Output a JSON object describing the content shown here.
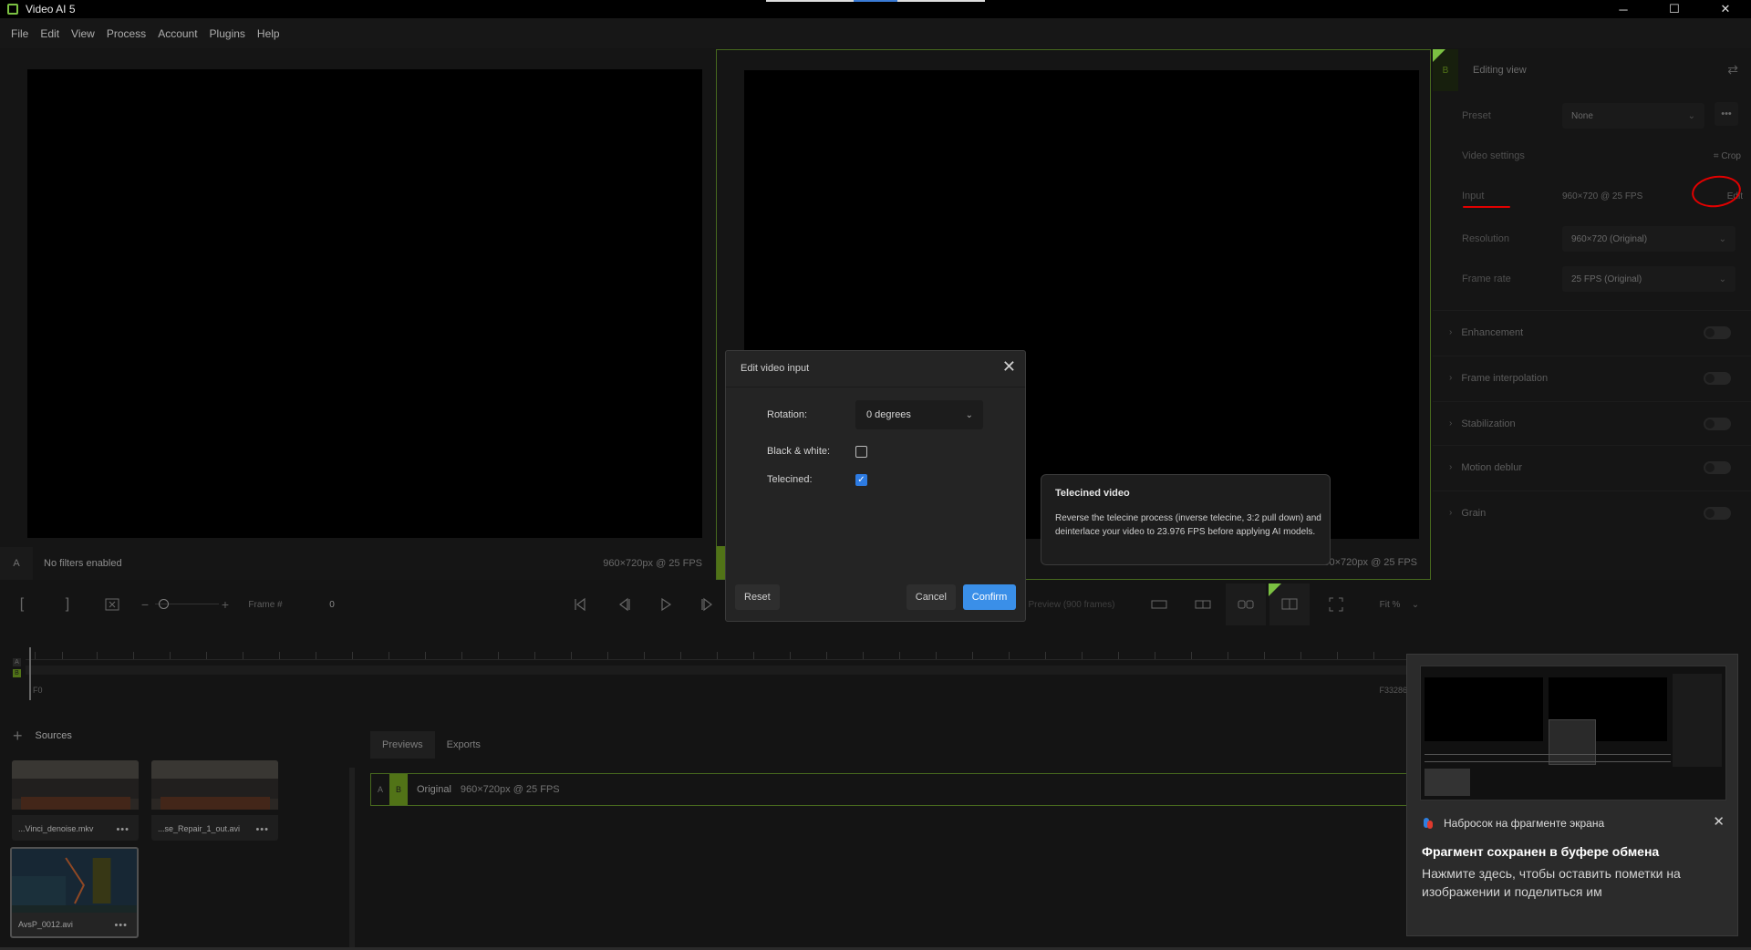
{
  "window": {
    "title": "Video AI 5",
    "controls": [
      "─",
      "☐",
      "✕"
    ]
  },
  "menu": [
    "File",
    "Edit",
    "View",
    "Process",
    "Account",
    "Plugins",
    "Help"
  ],
  "viewer_a": {
    "tag": "A",
    "filters": "No filters enabled",
    "resolution": "960×720px @ 25 FPS"
  },
  "viewer_b": {
    "resolution": "960×720px @ 25 FPS"
  },
  "controls": {
    "frame_label": "Frame #",
    "frame_value": "0",
    "preview_label": "Preview (900 frames)",
    "zoom_label": "Fit %"
  },
  "timeline": {
    "start": "F0",
    "end": "F33286",
    "marker_a": "A",
    "marker_b": "B"
  },
  "sources": {
    "header": "Sources",
    "items": [
      {
        "name": "...Vinci_denoise.mkv",
        "dots": "•••"
      },
      {
        "name": "...se_Repair_1_out.avi",
        "dots": "•••"
      },
      {
        "name": "AvsP_0012.avi",
        "dots": "•••"
      }
    ]
  },
  "preview_tabs": [
    "Previews",
    "Exports"
  ],
  "preview_row": {
    "a": "A",
    "b": "B",
    "title": "Original",
    "meta": "960×720px @ 25 FPS"
  },
  "right_panel": {
    "tag": "B",
    "title": "Editing view",
    "preset_label": "Preset",
    "preset_value": "None",
    "more": "•••",
    "video_settings_label": "Video settings",
    "crop_label": "Crop",
    "input_label": "Input",
    "input_value": "960×720 @ 25 FPS",
    "edit_label": "Edit",
    "resolution_label": "Resolution",
    "resolution_value": "960×720 (Original)",
    "framerate_label": "Frame rate",
    "framerate_value": "25 FPS (Original)",
    "sections": [
      "Enhancement",
      "Frame interpolation",
      "Stabilization",
      "Motion deblur",
      "Grain"
    ]
  },
  "modal": {
    "title": "Edit video input",
    "rotation_label": "Rotation:",
    "rotation_value": "0 degrees",
    "bw_label": "Black & white:",
    "telecined_label": "Telecined:",
    "telecined_checked": true,
    "bw_checked": false,
    "reset": "Reset",
    "cancel": "Cancel",
    "confirm": "Confirm"
  },
  "tooltip": {
    "title": "Telecined video",
    "text": "Reverse the telecine process (inverse telecine, 3:2 pull down) and deinterlace your video to 23.976 FPS before applying AI models."
  },
  "notification": {
    "app": "Набросок на фрагменте экрана",
    "title": "Фрагмент сохранен в буфере обмена",
    "body": "Нажмите здесь, чтобы оставить пометки на изображении и поделиться им"
  },
  "colors": {
    "accent_green": "#6c9a1f",
    "confirm_blue": "#3a8fe8",
    "annotation_red": "#e10000"
  }
}
